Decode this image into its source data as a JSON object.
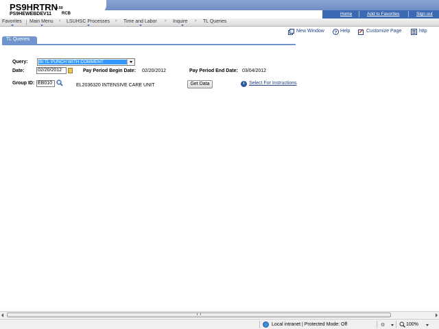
{
  "header": {
    "title": "PS9HRTRN",
    "version": "8.50",
    "database": "PS9HEWEBDEV11",
    "user": "RCB",
    "links": [
      "Home",
      "Add to Favorites",
      "Sign out"
    ]
  },
  "nav": {
    "items": [
      "Favorites",
      "Main Menu",
      "LSUHSC Processes",
      "Time and Labor",
      "Inquire",
      "TL Queries"
    ],
    "separator": "›"
  },
  "toolbar": {
    "new_window": "New Window",
    "help": "Help",
    "customize_page": "Customize Page",
    "http": "http"
  },
  "tab": {
    "label": "TL Queries"
  },
  "form": {
    "query_label": "Query:",
    "query_value": "BI TL PUNCH WITH COMMENT",
    "date_label": "Date:",
    "date_value": "02/20/2012",
    "begin_label": "Pay Period Begin Date:",
    "begin_value": "02/20/2012",
    "end_label": "Pay Period End Date:",
    "end_value": "03/04/2012",
    "group_label": "Group ID:",
    "group_value": "EB010",
    "group_description": "EL2036320 INTENSIVE CARE UNIT",
    "get_data": "Get Data",
    "instructions_link": "Select For Instructions"
  },
  "statusbar": {
    "zone": "Local intranet | Protected Mode: Off",
    "zoom": "100%"
  },
  "colors": {
    "header_band": "#6f8dc4",
    "header_links_bg": "#3c6ab2",
    "tab": "#6f95cc",
    "link": "#1f3e83",
    "selection": "#3399ff"
  }
}
